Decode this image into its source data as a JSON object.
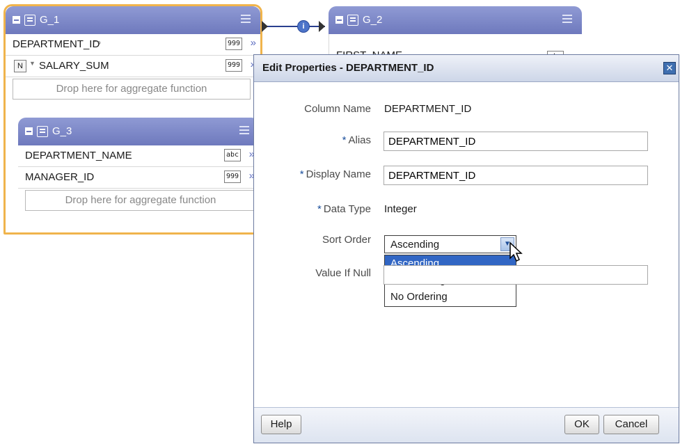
{
  "groups": {
    "g1": {
      "title": "G_1",
      "rows": [
        {
          "label": "DEPARTMENT_ID",
          "type": "999"
        },
        {
          "label": "SALARY_SUM",
          "type": "999",
          "badge": "N"
        }
      ],
      "drop_text": "Drop here for aggregate function"
    },
    "g2": {
      "title": "G_2",
      "rows": [
        {
          "label": "FIRST_NAME",
          "type": "abc"
        }
      ]
    },
    "g3": {
      "title": "G_3",
      "rows": [
        {
          "label": "DEPARTMENT_NAME",
          "type": "abc"
        },
        {
          "label": "MANAGER_ID",
          "type": "999"
        }
      ],
      "drop_text": "Drop here for aggregate function"
    }
  },
  "dialog": {
    "title": "Edit Properties - DEPARTMENT_ID",
    "column_name_label": "Column Name",
    "column_name_value": "DEPARTMENT_ID",
    "alias_label": "Alias",
    "alias_value": "DEPARTMENT_ID",
    "display_name_label": "Display Name",
    "display_name_value": "DEPARTMENT_ID",
    "data_type_label": "Data Type",
    "data_type_value": "Integer",
    "sort_order_label": "Sort Order",
    "sort_order_value": "Ascending",
    "sort_order_options": [
      "Ascending",
      "Descending",
      "No Ordering"
    ],
    "value_if_null_label": "Value If Null",
    "value_if_null_value": "",
    "required_marker": "*",
    "help_label": "Help",
    "ok_label": "OK",
    "cancel_label": "Cancel",
    "close_glyph": "✕"
  },
  "colors": {
    "group_header": "#7b86c6",
    "selection_border": "#f0b44c",
    "option_highlight": "#3166c4",
    "link_line": "#2a3f8f"
  }
}
